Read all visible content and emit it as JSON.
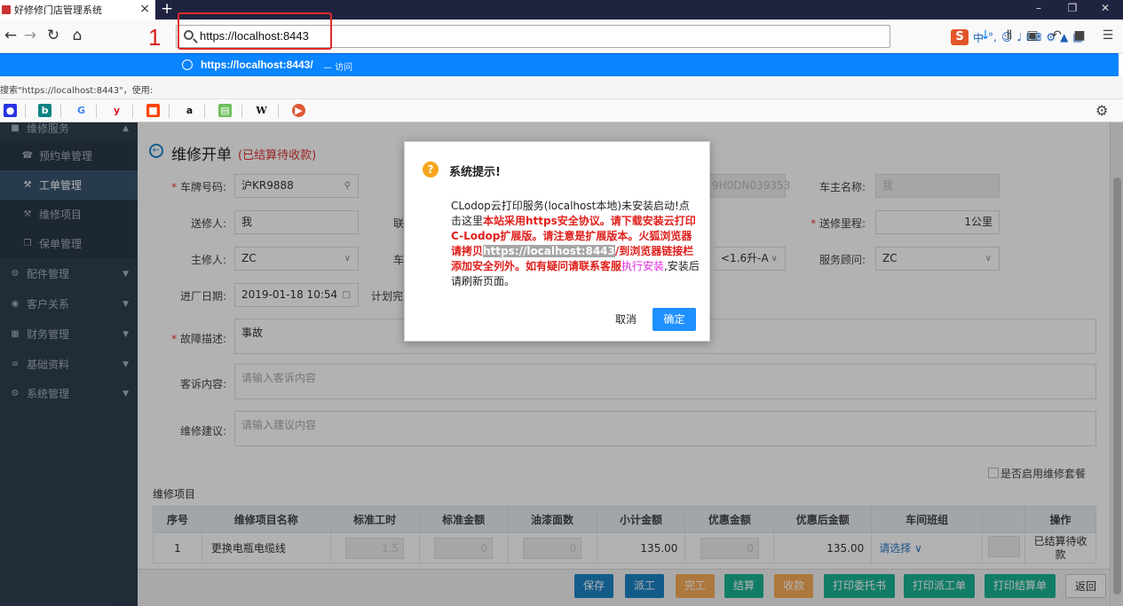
{
  "browser": {
    "tab_title": "好修修门店管理系统",
    "tab_close": "×",
    "new_tab": "+",
    "url": "https://localhost:8443",
    "step_marker": "1",
    "ime_brand": "S",
    "ime_lang": "中",
    "suggestion_url": "https://localhost:8443/",
    "suggestion_action": "— 访问",
    "search_line": "搜索\"https://localhost:8443\"，使用:"
  },
  "sidebar": {
    "items": [
      {
        "label": "维修服务",
        "icon": "car-icon"
      },
      {
        "label": "预约单管理",
        "icon": "phone-icon"
      },
      {
        "label": "工单管理",
        "icon": "wrench-icon"
      },
      {
        "label": "维修项目",
        "icon": "wrench-icon"
      },
      {
        "label": "保单管理",
        "icon": "copy-icon"
      },
      {
        "label": "配件管理",
        "icon": "cogs-icon"
      },
      {
        "label": "客户关系",
        "icon": "user-circle-icon"
      },
      {
        "label": "财务管理",
        "icon": "calculator-icon"
      },
      {
        "label": "基础资料",
        "icon": "database-icon"
      },
      {
        "label": "系统管理",
        "icon": "gears-icon"
      }
    ]
  },
  "page": {
    "title": "维修开单",
    "status": "(已结算待收款)"
  },
  "form": {
    "plate_label": "车牌号码:",
    "plate_value": "沪KR9888",
    "vin_partial": "9H0DN039353",
    "owner_name_label": "车主名称:",
    "owner_name_value": "我",
    "sender_label": "送修人:",
    "sender_value": "我",
    "contact_label_partial": "联",
    "mileage_label": "送修里程:",
    "mileage_value": "1公里",
    "main_person_label": "主修人:",
    "main_person_value": "ZC",
    "vehicle_label_partial": "车",
    "engine_partial": "<1.6升-A",
    "advisor_label": "服务顾问:",
    "advisor_value": "ZC",
    "entry_date_label": "进厂日期:",
    "entry_date_value": "2019-01-18 10:54",
    "planned_label_partial": "计划完",
    "fault_label": "故障描述:",
    "fault_value": "事故",
    "complaint_label": "客诉内容:",
    "complaint_placeholder": "请输入客诉内容",
    "advice_label": "维修建议:",
    "advice_placeholder": "请输入建议内容"
  },
  "items_section": {
    "title": "维修项目",
    "package_label": "是否启用维修套餐",
    "headers": [
      "序号",
      "维修项目名称",
      "标准工时",
      "标准金额",
      "油漆面数",
      "小计金额",
      "优惠金额",
      "优惠后金额",
      "车间班组",
      "",
      "操作"
    ],
    "rows": [
      {
        "no": "1",
        "name": "更换电瓶电缆线",
        "std_hours": "1.5",
        "std_amount": "0",
        "paint_faces": "0",
        "subtotal": "135.00",
        "discount": "0",
        "after_discount": "135.00",
        "team": "请选择",
        "op": "已结算待收款"
      }
    ]
  },
  "actions": {
    "save": "保存",
    "dispatch": "派工",
    "complete": "完工",
    "settle": "结算",
    "collect": "收款",
    "print_commission": "打印委托书",
    "print_dispatch": "打印派工单",
    "print_settlement": "打印结算单",
    "back": "返回"
  },
  "dialog": {
    "title": "系统提示!",
    "text_1": "CLodop云打印服务(localhost本地)未安装启动!点击这里",
    "text_red_1": "本站采用https安全协议。请下载安装云打印C-Lodop扩展版。请注意是扩展版本。火狐浏览器请拷贝",
    "text_highlight": "https://localhost:8443",
    "text_red_2": "/到浏览器链接栏添加安全列外。如有疑问请联系客服",
    "text_link": "执行安装",
    "text_2": ",安装后请刷新页面。",
    "cancel": "取消",
    "ok": "确定"
  },
  "colors": {
    "sidebar_bg": "#2f4050",
    "accent_blue": "#1e90ff",
    "status_red": "#e0201c",
    "highlight_box": "#e02a2a"
  }
}
